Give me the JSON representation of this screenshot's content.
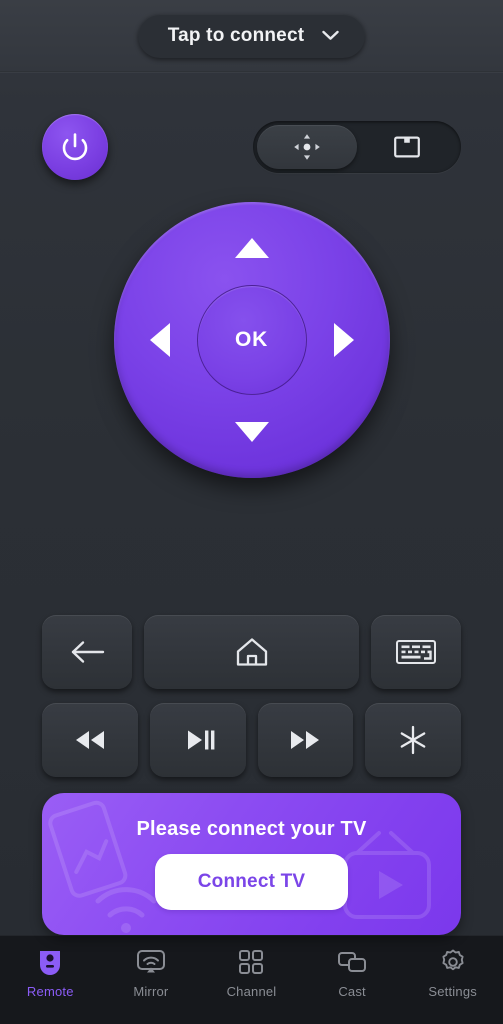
{
  "topbar": {
    "connect_label": "Tap to connect",
    "chevron_icon": "chevron-down-icon"
  },
  "controls": {
    "power_icon": "power-icon",
    "mode_toggle": {
      "options": [
        {
          "id": "dpad",
          "icon": "dpad-nav-icon",
          "selected": true
        },
        {
          "id": "touchpad",
          "icon": "touchpad-icon",
          "selected": false
        }
      ]
    },
    "dpad": {
      "ok_label": "OK",
      "up_icon": "arrow-up-icon",
      "down_icon": "arrow-down-icon",
      "left_icon": "arrow-left-icon",
      "right_icon": "arrow-right-icon"
    },
    "function_buttons": [
      {
        "id": "back",
        "icon": "back-arrow-icon"
      },
      {
        "id": "home",
        "icon": "home-icon"
      },
      {
        "id": "keyboard",
        "icon": "keyboard-icon"
      }
    ],
    "media_buttons": [
      {
        "id": "rewind",
        "icon": "rewind-icon"
      },
      {
        "id": "play-pause",
        "icon": "play-pause-icon"
      },
      {
        "id": "forward",
        "icon": "fast-forward-icon"
      },
      {
        "id": "asterisk",
        "icon": "asterisk-icon"
      }
    ]
  },
  "banner": {
    "title": "Please connect your TV",
    "button_label": "Connect TV"
  },
  "nav": {
    "items": [
      {
        "label": "Remote",
        "icon": "remote-icon",
        "active": true
      },
      {
        "label": "Mirror",
        "icon": "mirror-icon",
        "active": false
      },
      {
        "label": "Channel",
        "icon": "channel-grid-icon",
        "active": false
      },
      {
        "label": "Cast",
        "icon": "cast-icon",
        "active": false
      },
      {
        "label": "Settings",
        "icon": "gear-icon",
        "active": false
      }
    ]
  },
  "colors": {
    "accent_purple": "#7b42e8",
    "banner_purple": "#8c4cf2",
    "nav_active": "#8b5cf6",
    "background": "#2b2f35",
    "button_face": "#34383f"
  }
}
